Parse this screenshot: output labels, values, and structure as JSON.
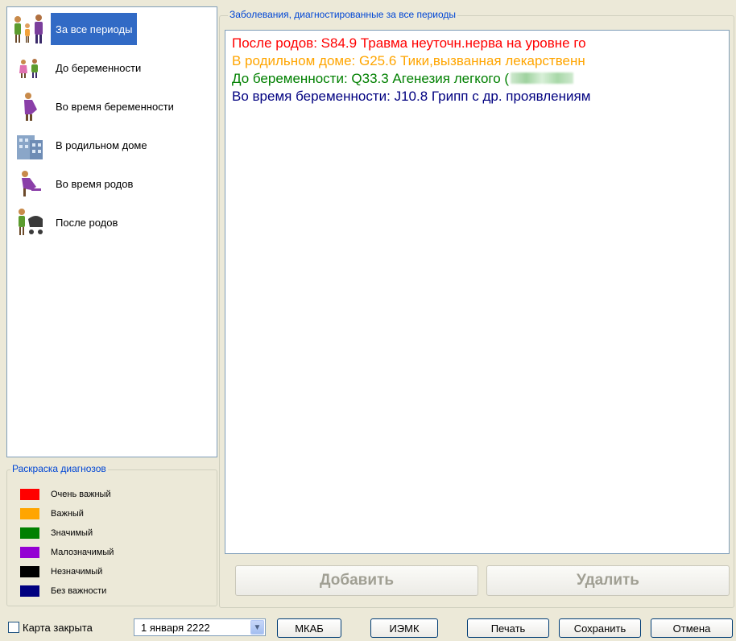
{
  "periods": [
    {
      "label": "За все периоды",
      "icon": "family-icon",
      "selected": true
    },
    {
      "label": "До беременности",
      "icon": "couple-icon",
      "selected": false
    },
    {
      "label": "Во время беременности",
      "icon": "pregnant-icon",
      "selected": false
    },
    {
      "label": "В родильном доме",
      "icon": "hospital-icon",
      "selected": false
    },
    {
      "label": "Во время родов",
      "icon": "labor-icon",
      "selected": false
    },
    {
      "label": "После родов",
      "icon": "stroller-icon",
      "selected": false
    }
  ],
  "legend": {
    "caption": "Раскраска диагнозов",
    "items": [
      {
        "label": "Очень важный",
        "color": "#FF0000"
      },
      {
        "label": "Важный",
        "color": "#FFA500"
      },
      {
        "label": "Значимый",
        "color": "#008000"
      },
      {
        "label": "Малозначимый",
        "color": "#9400D3"
      },
      {
        "label": "Незначимый",
        "color": "#000000"
      },
      {
        "label": "Без важности",
        "color": "#000080"
      }
    ]
  },
  "diagnoses": {
    "caption": "Заболевания, диагностированные за все периоды",
    "lines": [
      {
        "text": "После родов: S84.9 Травма неуточн.нерва на уровне го",
        "color": "#FF0000"
      },
      {
        "text": "В родильном доме: G25.6 Тики,вызванная лекарственн",
        "color": "#FFA500"
      },
      {
        "text": "До беременности: Q33.3 Агенезия легкого (",
        "color": "#008000"
      },
      {
        "text": "Во время беременности: J10.8 Грипп с др. проявлениям",
        "color": "#000080"
      }
    ]
  },
  "actions": {
    "add": "Добавить",
    "delete": "Удалить"
  },
  "footer": {
    "card_closed": "Карта закрыта",
    "date": "1   января  2222",
    "mkab": "МКАБ",
    "iemk": "ИЭМК",
    "print": "Печать",
    "save": "Сохранить",
    "cancel": "Отмена"
  }
}
